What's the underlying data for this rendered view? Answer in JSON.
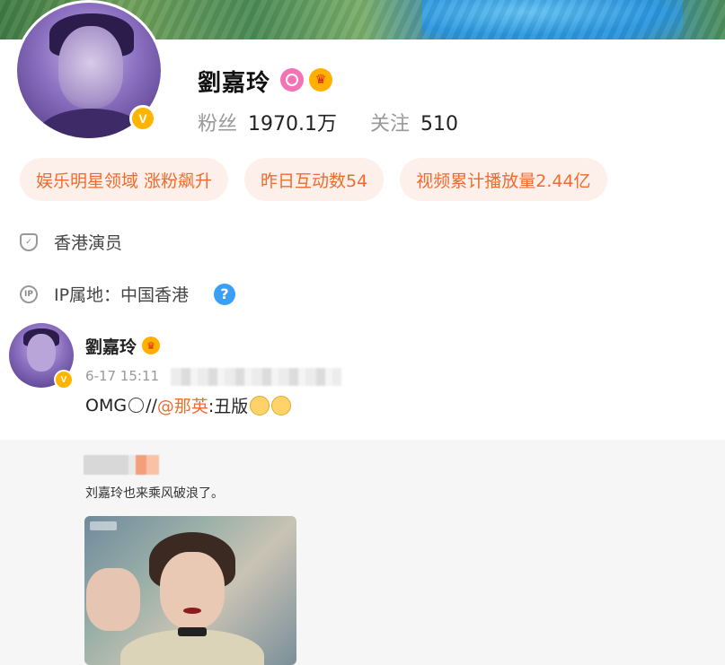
{
  "profile": {
    "name": "劉嘉玲",
    "fans_label": "粉丝",
    "fans_value": "1970.1万",
    "follow_label": "关注",
    "follow_value": "510"
  },
  "tags": [
    {
      "label": "娱乐明星领域 涨粉飙升"
    },
    {
      "label": "昨日互动数54"
    },
    {
      "label": "视频累计播放量2.44亿"
    }
  ],
  "info": {
    "occupation": "香港演员",
    "ip_location": "IP属地：中国香港"
  },
  "post": {
    "author": "劉嘉玲",
    "time": "6-17 15:11",
    "text_prefix": "OMG",
    "text_slashes": "//",
    "mention": "@那英",
    "text_after": ":丑版"
  },
  "repost": {
    "text": "刘嘉玲也来乘风破浪了。"
  },
  "colors": {
    "accent_orange": "#f06b2d",
    "tag_bg": "#fdf0ea",
    "verified_gold": "#ffb400",
    "help_blue": "#3ba0f5"
  },
  "icons": [
    "verified-badge-icon",
    "membership-badge-icon",
    "crown-icon",
    "shield-icon",
    "ip-icon",
    "help-icon",
    "thinking-emoji-icon",
    "smile-emoji-icon"
  ]
}
